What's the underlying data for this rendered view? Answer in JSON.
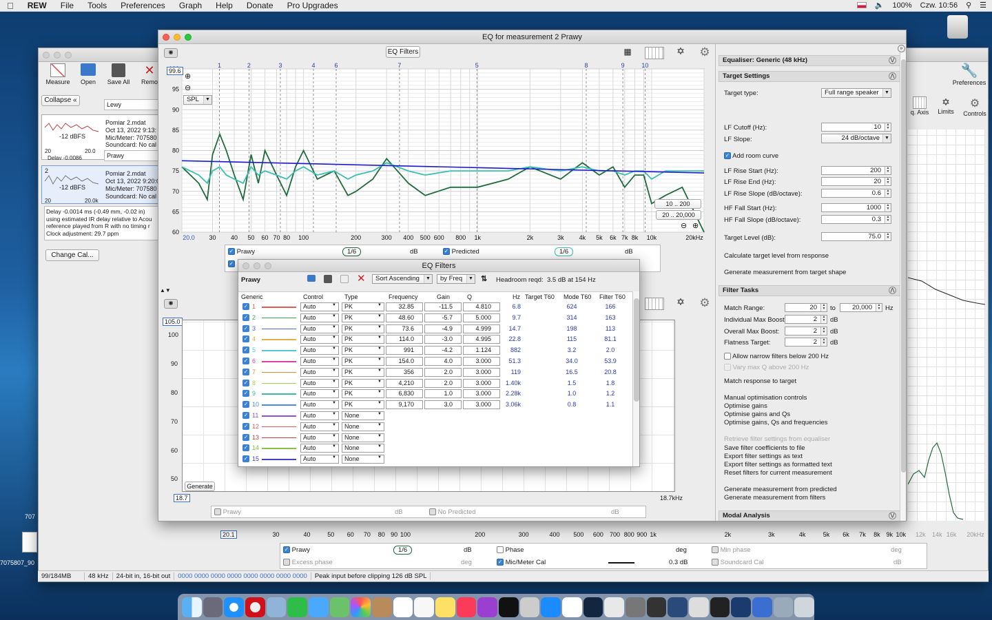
{
  "menubar": {
    "app": "REW",
    "items": [
      "File",
      "Tools",
      "Preferences",
      "Graph",
      "Help",
      "Donate",
      "Pro Upgrades"
    ],
    "battery": "100%",
    "clock": "Czw. 10:56"
  },
  "main_window": {
    "toolbar": [
      "Measure",
      "Open",
      "Save All",
      "Remo"
    ],
    "collapse": "Collapse",
    "meas1": {
      "channel": "Lewy",
      "name": "Pomiar 2.mdat",
      "date": "Oct 13, 2022 9:13:",
      "meter": "Mic/Meter: 707580",
      "soundcard": "Soundcard: No cal",
      "level": "-12 dBFS",
      "axis_a": "20",
      "axis_b": "20.0",
      "delay": "Delay -0.0086"
    },
    "meas2": {
      "channel": "Prawy",
      "name": "Pomiar 2.mdat",
      "date": "Oct 13, 2022 9:20:0",
      "meter": "Mic/Meter: 707580",
      "soundcard": "Soundcard: No cal",
      "level": "-12 dBFS",
      "axis_a": "20",
      "axis_b": "20.0k",
      "num": "2"
    },
    "delay_text": [
      "Delay -0.0014 ms (-0.49 mm, -0.02 in)",
      "using estimated IR delay relative to Acou",
      "reference played from  R with no timing r",
      "Clock adjustment: 29.7 ppm"
    ],
    "change_cal": "Change Cal...",
    "right_tools": [
      "Preferences",
      "q. Axis",
      "Limits",
      "Controls"
    ],
    "bottom_axis": [
      "20.1",
      "30",
      "40",
      "50",
      "60",
      "70",
      "80",
      "90",
      "100",
      "200",
      "300",
      "400",
      "500",
      "600",
      "700",
      "800",
      "900",
      "1k",
      "2k",
      "3k",
      "4k",
      "5k",
      "6k",
      "7k",
      "8k",
      "9k",
      "10k",
      "12k",
      "14k",
      "16k",
      "20kHz"
    ],
    "legend1": [
      "Prawy",
      "dB",
      "Phase",
      "deg",
      "Min phase",
      "deg"
    ],
    "legend2": [
      "Excess phase",
      "deg",
      "Mic/Meter Cal",
      "0.3 dB",
      "Soundcard Cal",
      "dB"
    ],
    "smooth": "1/6",
    "status": [
      "99/184MB",
      "48 kHz",
      "24-bit in, 16-bit out",
      "0000 0000  0000 0000  0000 0000  0000 0000",
      "Peak input before clipping 126 dB SPL"
    ],
    "desktop": [
      "707",
      "7075807_90"
    ]
  },
  "eq_window": {
    "title": "EQ for measurement 2 Prawy",
    "eq_filters_button": "EQ Filters",
    "spl_value": "99.6",
    "spl_mode": "SPL",
    "chart_markers": [
      "1",
      "2",
      "3",
      "4",
      "6",
      "7",
      "5",
      "8",
      "9",
      "10"
    ],
    "range_btns": [
      "10 .. 200",
      "20 .. 20,000"
    ],
    "legend": [
      "Prawy",
      "dB",
      "Predicted",
      "dB"
    ],
    "smooth": "1/6",
    "lower": {
      "spl_value": "105.0",
      "y_ticks": [
        "100",
        "90",
        "80",
        "70",
        "60",
        "50"
      ],
      "generate": "Generate",
      "x_start": "18.7",
      "x_end": "18.7kHz",
      "legend": [
        "Prawy",
        "dB",
        "No Predicted",
        "dB"
      ]
    }
  },
  "chart_data": {
    "type": "line",
    "x_scale": "log",
    "xlim": [
      20,
      20000
    ],
    "ylim": [
      60,
      100
    ],
    "y_ticks": [
      100,
      95,
      90,
      85,
      80,
      75,
      70,
      65,
      60
    ],
    "x_ticks": [
      "20.0",
      "30",
      "40",
      "50",
      "60",
      "70",
      "80",
      "100",
      "200",
      "300",
      "400",
      "500",
      "600",
      "800",
      "1k",
      "2k",
      "3k",
      "4k",
      "5k",
      "6k",
      "7k",
      "8k",
      "10k",
      "20kHz"
    ],
    "series": [
      {
        "name": "Prawy",
        "color": "#1f6b3c",
        "x": [
          20,
          25,
          28,
          30,
          33,
          36,
          40,
          45,
          50,
          55,
          60,
          70,
          80,
          90,
          100,
          120,
          150,
          180,
          200,
          250,
          300,
          400,
          500,
          700,
          1000,
          1500,
          2000,
          3000,
          4000,
          5000,
          6000,
          7000,
          8000,
          9000,
          10000,
          12000,
          15000,
          20000
        ],
        "y": [
          76,
          72,
          68,
          79,
          84,
          80,
          74,
          68,
          79,
          72,
          80,
          74,
          69,
          76,
          80,
          73,
          75,
          69,
          70,
          73,
          78,
          72,
          69,
          71,
          71,
          73,
          76,
          73,
          77,
          74,
          76,
          71,
          74,
          74,
          67,
          69,
          71,
          60
        ]
      },
      {
        "name": "Predicted",
        "color": "#3bbfb2",
        "x": [
          20,
          25,
          28,
          30,
          33,
          36,
          40,
          45,
          50,
          55,
          60,
          70,
          80,
          90,
          100,
          120,
          150,
          180,
          200,
          250,
          300,
          400,
          500,
          700,
          1000,
          1500,
          2000,
          3000,
          4000,
          5000,
          6000,
          7000,
          8000,
          9000,
          10000,
          12000,
          15000,
          20000
        ],
        "y": [
          76,
          74,
          72,
          75,
          76,
          74,
          73,
          72,
          76,
          74,
          75,
          74,
          73,
          75,
          76,
          74,
          75,
          73,
          74,
          75,
          77,
          75,
          74,
          75,
          75,
          75,
          76,
          75,
          76,
          75,
          75,
          74,
          75,
          75,
          73,
          75,
          75,
          75
        ]
      },
      {
        "name": "Target",
        "color": "#1a1acc",
        "x": [
          20,
          20000
        ],
        "y": [
          77.5,
          74.5
        ]
      }
    ]
  },
  "eq_filters": {
    "title": "EQ Filters",
    "channel": "Prawy",
    "sort": "Sort Ascending",
    "by": "by Freq",
    "headroom": "Headroom reqd:",
    "headroom_val": "3.5 dB at 154 Hz",
    "headers": [
      "Generic",
      "Control",
      "Type",
      "Frequency",
      "Gain",
      "Q",
      "Hz",
      "Target T60",
      "Mode T60",
      "Filter T60"
    ],
    "rows": [
      {
        "n": "1",
        "color": "#e05a5a",
        "control": "Auto",
        "type": "PK",
        "freq": "32.85",
        "gain": "-11.5",
        "q": "4.810",
        "hz": "6.8",
        "mode": "624",
        "filter": "166"
      },
      {
        "n": "2",
        "color": "#3aa84a",
        "control": "Auto",
        "type": "PK",
        "freq": "48.60",
        "gain": "-5.7",
        "q": "5.000",
        "hz": "9.7",
        "mode": "314",
        "filter": "163"
      },
      {
        "n": "3",
        "color": "#4a6ad8",
        "control": "Auto",
        "type": "PK",
        "freq": "73.6",
        "gain": "-4.9",
        "q": "4.999",
        "hz": "14.7",
        "mode": "198",
        "filter": "113"
      },
      {
        "n": "4",
        "color": "#e0b040",
        "control": "Auto",
        "type": "PK",
        "freq": "114.0",
        "gain": "-3.0",
        "q": "4.995",
        "hz": "22.8",
        "mode": "115",
        "filter": "81.1"
      },
      {
        "n": "5",
        "color": "#50c8d8",
        "control": "Auto",
        "type": "PK",
        "freq": "991",
        "gain": "-4.2",
        "q": "1.124",
        "hz": "882",
        "mode": "3.2",
        "filter": "2.0"
      },
      {
        "n": "6",
        "color": "#e040a0",
        "control": "Auto",
        "type": "PK",
        "freq": "154.0",
        "gain": "4.0",
        "q": "3.000",
        "hz": "51.3",
        "mode": "34.0",
        "filter": "53.9"
      },
      {
        "n": "7",
        "color": "#e08a40",
        "control": "Auto",
        "type": "PK",
        "freq": "356",
        "gain": "2.0",
        "q": "3.000",
        "hz": "119",
        "mode": "16.5",
        "filter": "20.8"
      },
      {
        "n": "8",
        "color": "#a0d050",
        "control": "Auto",
        "type": "PK",
        "freq": "4,210",
        "gain": "2.0",
        "q": "3.000",
        "hz": "1.40k",
        "mode": "1.5",
        "filter": "1.8"
      },
      {
        "n": "9",
        "color": "#40b8a0",
        "control": "Auto",
        "type": "PK",
        "freq": "6,830",
        "gain": "1.0",
        "q": "3.000",
        "hz": "2.28k",
        "mode": "1.0",
        "filter": "1.2"
      },
      {
        "n": "10",
        "color": "#4a8ad8",
        "control": "Auto",
        "type": "PK",
        "freq": "9,170",
        "gain": "3.0",
        "q": "3.000",
        "hz": "3.06k",
        "mode": "0.8",
        "filter": "1.1"
      },
      {
        "n": "11",
        "color": "#9050d0",
        "control": "Auto",
        "type": "None"
      },
      {
        "n": "12",
        "color": "#e05a5a",
        "control": "Auto",
        "type": "None"
      },
      {
        "n": "13",
        "color": "#c04040",
        "control": "Auto",
        "type": "None"
      },
      {
        "n": "14",
        "color": "#88c040",
        "control": "Auto",
        "type": "None"
      },
      {
        "n": "15",
        "color": "#4040c8",
        "control": "Auto",
        "type": "None"
      }
    ]
  },
  "right_panel": {
    "equaliser": "Equaliser: Generic (48 kHz)",
    "target_settings": "Target Settings",
    "target_type_label": "Target type:",
    "target_type": "Full range speaker",
    "lf_cutoff_label": "LF Cutoff (Hz):",
    "lf_cutoff": "10",
    "lf_slope_label": "LF Slope:",
    "lf_slope": "24 dB/octave",
    "add_room": "Add room curve",
    "lf_rise_start_label": "LF Rise Start (Hz):",
    "lf_rise_start": "200",
    "lf_rise_end_label": "LF Rise End (Hz):",
    "lf_rise_end": "20",
    "lf_rise_slope_label": "LF Rise Slope (dB/octave):",
    "lf_rise_slope": "0.6",
    "hf_fall_start_label": "HF Fall Start (Hz):",
    "hf_fall_start": "1000",
    "hf_fall_slope_label": "HF Fall Slope (dB/octave):",
    "hf_fall_slope": "0.3",
    "target_level_label": "Target Level (dB):",
    "target_level": "75.0",
    "calc_target": "Calculate target level from response",
    "gen_target": "Generate measurement from target shape",
    "filter_tasks": "Filter Tasks",
    "match_range_label": "Match Range:",
    "match_from": "20",
    "to": "to",
    "match_to": "20,000",
    "hz": "Hz",
    "ind_boost_label": "Individual Max Boost:",
    "ind_boost": "2",
    "overall_boost_label": "Overall Max Boost:",
    "overall_boost": "2",
    "flatness_label": "Flatness Target:",
    "flatness": "2",
    "db": "dB",
    "allow_narrow": "Allow narrow filters below 200 Hz",
    "vary_q": "Vary max Q above 200 Hz",
    "match_response": "Match response to target",
    "manual": "Manual optimisation controls",
    "opt1": "Optimise gains",
    "opt2": "Optimise gains and Qs",
    "opt3": "Optimise gains, Qs and frequencies",
    "retrieve": "Retrieve filter settings from equaliser",
    "save_coef": "Save filter coefficients to file",
    "export_text": "Export filter settings as text",
    "export_fmt": "Export filter settings as formatted text",
    "reset": "Reset filters for current measurement",
    "gen_pred": "Generate measurement from predicted",
    "gen_filt": "Generate measurement from filters",
    "modal": "Modal Analysis"
  },
  "colors": {
    "accent": "#3a82d6",
    "prawy": "#1f6b3c",
    "predicted": "#3bbfb2",
    "target": "#1a1acc"
  }
}
